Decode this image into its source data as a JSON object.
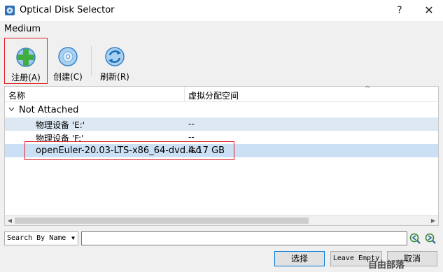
{
  "window": {
    "title": "Optical Disk Selector",
    "help_label": "?",
    "close_label": "✕"
  },
  "medium_label": "Medium",
  "toolbar": {
    "register_label": "注册(A)",
    "create_label": "创建(C)",
    "refresh_label": "刷新(R)"
  },
  "tree": {
    "columns": [
      "名称",
      "虚拟分配空间"
    ],
    "sort_indicator": "^",
    "group_label": "Not Attached",
    "rows": [
      {
        "name": "物理设备 'E:'",
        "size": "--"
      },
      {
        "name": "物理设备 'F:'",
        "size": "--"
      },
      {
        "name": "openEuler-20.03-LTS-x86_64-dvd.iso",
        "size": "4.17 GB"
      }
    ]
  },
  "search": {
    "mode": "Search By Name",
    "value": ""
  },
  "buttons": {
    "choose": "选择",
    "leave_empty": "Leave Empty",
    "cancel": "取消"
  },
  "watermark": "自由部落",
  "colors": {
    "highlight_box": "#e0202a",
    "selected_row": "#cce0f5",
    "alt_row": "#dde8f3"
  }
}
